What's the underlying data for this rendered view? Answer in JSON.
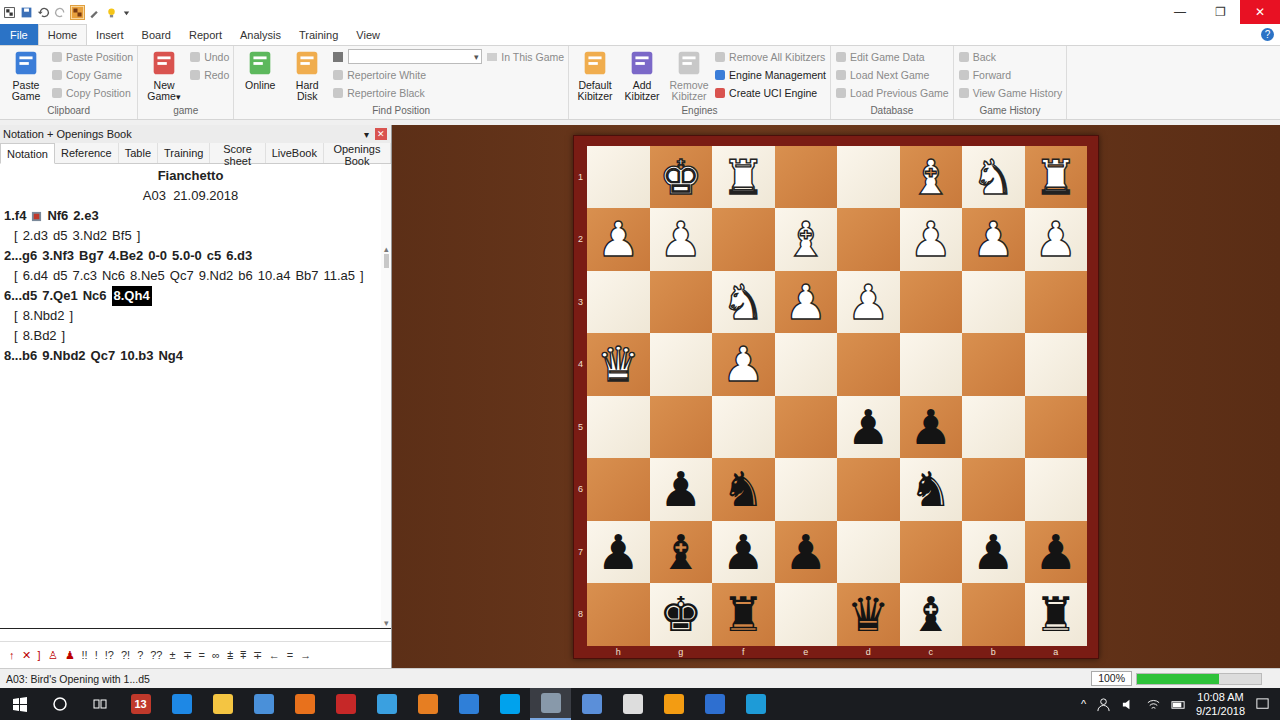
{
  "window": {
    "title": "",
    "controls": [
      "—",
      "❐",
      "✕"
    ]
  },
  "ribbon": {
    "tabs": [
      {
        "label": "File",
        "selected": false,
        "kind": "file"
      },
      {
        "label": "Home",
        "selected": true,
        "kind": "tab"
      },
      {
        "label": "Insert",
        "selected": false,
        "kind": "tab"
      },
      {
        "label": "Board",
        "selected": false,
        "kind": "tab"
      },
      {
        "label": "Report",
        "selected": false,
        "kind": "tab"
      },
      {
        "label": "Analysis",
        "selected": false,
        "kind": "tab"
      },
      {
        "label": "Training",
        "selected": false,
        "kind": "tab"
      },
      {
        "label": "View",
        "selected": false,
        "kind": "tab"
      }
    ],
    "help": "?",
    "groups": [
      {
        "label": "Clipboard",
        "columns": [
          [
            {
              "kind": "large",
              "label": "Paste Game",
              "disabled": false
            }
          ],
          [
            {
              "kind": "small",
              "label": "Paste Position",
              "disabled": true
            },
            {
              "kind": "small",
              "label": "Copy Game",
              "disabled": true
            },
            {
              "kind": "small",
              "label": "Copy Position",
              "disabled": true
            }
          ]
        ]
      },
      {
        "label": "game",
        "columns": [
          [
            {
              "kind": "large",
              "label": "New Game",
              "disabled": false,
              "dropdown": "▾"
            }
          ],
          [
            {
              "kind": "small",
              "label": "Undo",
              "disabled": true
            },
            {
              "kind": "small",
              "label": "Redo",
              "disabled": true
            }
          ]
        ]
      },
      {
        "label": "Find Position",
        "columns": [
          [
            {
              "kind": "large",
              "label": "Online",
              "disabled": false
            }
          ],
          [
            {
              "kind": "large",
              "label": "Hard Disk",
              "disabled": false
            }
          ],
          [
            {
              "kind": "search",
              "label": "In This Game",
              "value": "",
              "arrow": "▾",
              "disabled": true
            },
            {
              "kind": "small",
              "label": "Repertoire White",
              "disabled": true
            },
            {
              "kind": "small",
              "label": "Repertoire Black",
              "disabled": true
            }
          ]
        ]
      },
      {
        "label": "Engines",
        "columns": [
          [
            {
              "kind": "large",
              "label": "Default Kibitzer",
              "disabled": false
            }
          ],
          [
            {
              "kind": "large",
              "label": "Add Kibitzer",
              "disabled": false
            }
          ],
          [
            {
              "kind": "large",
              "label": "Remove Kibitzer",
              "disabled": true
            }
          ],
          [
            {
              "kind": "small",
              "label": "Remove All Kibitzers",
              "disabled": true
            },
            {
              "kind": "small",
              "label": "Engine Management",
              "disabled": false
            },
            {
              "kind": "small",
              "label": "Create UCI Engine",
              "disabled": false
            }
          ]
        ]
      },
      {
        "label": "Database",
        "columns": [
          [
            {
              "kind": "small",
              "label": "Edit Game Data",
              "disabled": true
            },
            {
              "kind": "small",
              "label": "Load Next Game",
              "disabled": true
            },
            {
              "kind": "small",
              "label": "Load Previous Game",
              "disabled": true
            }
          ]
        ]
      },
      {
        "label": "Game History",
        "columns": [
          [
            {
              "kind": "small",
              "label": "Back",
              "disabled": true
            },
            {
              "kind": "small",
              "label": "Forward",
              "disabled": true
            },
            {
              "kind": "small",
              "label": "View Game History",
              "disabled": true
            }
          ]
        ]
      }
    ]
  },
  "panel": {
    "title": "Notation + Openings Book",
    "menu": "▾",
    "close": "✕",
    "tabs": [
      {
        "label": "Notation",
        "selected": true
      },
      {
        "label": "Reference",
        "selected": false
      },
      {
        "label": "Table",
        "selected": false
      },
      {
        "label": "Training",
        "selected": false
      },
      {
        "label": "Score sheet",
        "selected": false
      },
      {
        "label": "LiveBook",
        "selected": false
      },
      {
        "label": "Openings Book",
        "selected": false
      }
    ],
    "game_title": "Fianchetto",
    "game_info": "A03  21.09.2018",
    "scroll": {
      "up": "▴",
      "down": "▾"
    },
    "lines": [
      {
        "kind": "main",
        "tokens": [
          {
            "text": "1.f4",
            "selected": false,
            "marked": true
          },
          {
            "text": "Nf6",
            "selected": false,
            "marked": false
          },
          {
            "text": "2.e3",
            "selected": false,
            "marked": false
          }
        ]
      },
      {
        "kind": "variation",
        "tokens": [
          {
            "text": "[",
            "selected": false,
            "marked": false
          },
          {
            "text": "2.d3",
            "selected": false,
            "marked": false
          },
          {
            "text": "d5",
            "selected": false,
            "marked": false
          },
          {
            "text": "3.Nd2",
            "selected": false,
            "marked": false
          },
          {
            "text": "Bf5",
            "selected": false,
            "marked": false
          },
          {
            "text": "]",
            "selected": false,
            "marked": false
          }
        ]
      },
      {
        "kind": "main",
        "tokens": [
          {
            "text": "2...g6",
            "selected": false,
            "marked": false
          },
          {
            "text": "3.Nf3",
            "selected": false,
            "marked": false
          },
          {
            "text": "Bg7",
            "selected": false,
            "marked": false
          },
          {
            "text": "4.Be2",
            "selected": false,
            "marked": false
          },
          {
            "text": "0-0",
            "selected": false,
            "marked": false
          },
          {
            "text": "5.0-0",
            "selected": false,
            "marked": false
          },
          {
            "text": "c5",
            "selected": false,
            "marked": false
          },
          {
            "text": "6.d3",
            "selected": false,
            "marked": false
          }
        ]
      },
      {
        "kind": "variation",
        "tokens": [
          {
            "text": "[",
            "selected": false,
            "marked": false
          },
          {
            "text": "6.d4",
            "selected": false,
            "marked": false
          },
          {
            "text": "d5",
            "selected": false,
            "marked": false
          },
          {
            "text": "7.c3",
            "selected": false,
            "marked": false
          },
          {
            "text": "Nc6",
            "selected": false,
            "marked": false
          },
          {
            "text": "8.Ne5",
            "selected": false,
            "marked": false
          },
          {
            "text": "Qc7",
            "selected": false,
            "marked": false
          },
          {
            "text": "9.Nd2",
            "selected": false,
            "marked": false
          },
          {
            "text": "b6",
            "selected": false,
            "marked": false
          },
          {
            "text": "10.a4",
            "selected": false,
            "marked": false
          },
          {
            "text": "Bb7",
            "selected": false,
            "marked": false
          },
          {
            "text": "11.a5",
            "selected": false,
            "marked": false
          },
          {
            "text": "]",
            "selected": false,
            "marked": false
          }
        ]
      },
      {
        "kind": "main",
        "tokens": [
          {
            "text": "6...d5",
            "selected": false,
            "marked": false
          },
          {
            "text": "7.Qe1",
            "selected": false,
            "marked": false
          },
          {
            "text": "Nc6",
            "selected": false,
            "marked": false
          },
          {
            "text": "8.Qh4",
            "selected": true,
            "marked": false
          }
        ]
      },
      {
        "kind": "variation",
        "tokens": [
          {
            "text": "[",
            "selected": false,
            "marked": false
          },
          {
            "text": "8.Nbd2",
            "selected": false,
            "marked": false
          },
          {
            "text": "]",
            "selected": false,
            "marked": false
          }
        ]
      },
      {
        "kind": "variation",
        "tokens": [
          {
            "text": "[",
            "selected": false,
            "marked": false
          },
          {
            "text": "8.Bd2",
            "selected": false,
            "marked": false
          },
          {
            "text": "]",
            "selected": false,
            "marked": false
          }
        ]
      },
      {
        "kind": "main",
        "tokens": [
          {
            "text": "8...b6",
            "selected": false,
            "marked": false
          },
          {
            "text": "9.Nbd2",
            "selected": false,
            "marked": false
          },
          {
            "text": "Qc7",
            "selected": false,
            "marked": false
          },
          {
            "text": "10.b3",
            "selected": false,
            "marked": false
          },
          {
            "text": "Ng4",
            "selected": false,
            "marked": false
          }
        ]
      }
    ],
    "symbols": [
      "↑",
      "✕",
      "]",
      "♙",
      "♟",
      "!!",
      "!",
      "!?",
      "?!",
      "?",
      "??",
      "±",
      "∓",
      "=",
      "∞",
      "⩲",
      "⩱",
      "∓",
      "←",
      "=",
      "→"
    ]
  },
  "board": {
    "files": [
      "h",
      "g",
      "f",
      "e",
      "d",
      "c",
      "b",
      "a"
    ],
    "ranks": [
      {
        "label": "1",
        "squares": [
          "",
          {
            "glyph": "♚",
            "side": "white"
          },
          {
            "glyph": "♜",
            "side": "white"
          },
          "",
          "",
          {
            "glyph": "♝",
            "side": "white"
          },
          {
            "glyph": "♞",
            "side": "white"
          },
          {
            "glyph": "♜",
            "side": "white"
          }
        ]
      },
      {
        "label": "2",
        "squares": [
          {
            "glyph": "♟",
            "side": "white"
          },
          {
            "glyph": "♟",
            "side": "white"
          },
          "",
          {
            "glyph": "♝",
            "side": "white"
          },
          "",
          {
            "glyph": "♟",
            "side": "white"
          },
          {
            "glyph": "♟",
            "side": "white"
          },
          {
            "glyph": "♟",
            "side": "white"
          }
        ]
      },
      {
        "label": "3",
        "squares": [
          "",
          "",
          {
            "glyph": "♞",
            "side": "white"
          },
          {
            "glyph": "♟",
            "side": "white"
          },
          {
            "glyph": "♟",
            "side": "white"
          },
          "",
          "",
          ""
        ]
      },
      {
        "label": "4",
        "squares": [
          {
            "glyph": "♛",
            "side": "white"
          },
          "",
          {
            "glyph": "♟",
            "side": "white"
          },
          "",
          "",
          "",
          "",
          ""
        ]
      },
      {
        "label": "5",
        "squares": [
          "",
          "",
          "",
          "",
          {
            "glyph": "♟",
            "side": "black"
          },
          {
            "glyph": "♟",
            "side": "black"
          },
          "",
          ""
        ]
      },
      {
        "label": "6",
        "squares": [
          "",
          {
            "glyph": "♟",
            "side": "black"
          },
          {
            "glyph": "♞",
            "side": "black"
          },
          "",
          "",
          {
            "glyph": "♞",
            "side": "black"
          },
          "",
          ""
        ]
      },
      {
        "label": "7",
        "squares": [
          {
            "glyph": "♟",
            "side": "black"
          },
          {
            "glyph": "♝",
            "side": "black"
          },
          {
            "glyph": "♟",
            "side": "black"
          },
          {
            "glyph": "♟",
            "side": "black"
          },
          "",
          "",
          {
            "glyph": "♟",
            "side": "black"
          },
          {
            "glyph": "♟",
            "side": "black"
          }
        ]
      },
      {
        "label": "8",
        "squares": [
          "",
          {
            "glyph": "♚",
            "side": "black"
          },
          {
            "glyph": "♜",
            "side": "black"
          },
          "",
          {
            "glyph": "♛",
            "side": "black"
          },
          {
            "glyph": "♝",
            "side": "black"
          },
          "",
          {
            "glyph": "♜",
            "side": "black"
          }
        ]
      }
    ]
  },
  "status_bar": {
    "text": "A03: Bird's Opening with 1...d5",
    "zoom": "100%",
    "level": 0.66
  },
  "taskbar": {
    "apps": [
      {
        "text": "13",
        "color": "#c0392b",
        "active": false
      },
      {
        "text": "",
        "color": "#1e88e5",
        "active": false
      },
      {
        "text": "",
        "color": "#f4c542",
        "active": false
      },
      {
        "text": "",
        "color": "#4a90d9",
        "active": false
      },
      {
        "text": "",
        "color": "#e8711c",
        "active": false
      },
      {
        "text": "",
        "color": "#c62828",
        "active": false
      },
      {
        "text": "",
        "color": "#3aa0e0",
        "active": false
      },
      {
        "text": "",
        "color": "#e67e22",
        "active": false
      },
      {
        "text": "",
        "color": "#2f7fd8",
        "active": false
      },
      {
        "text": "",
        "color": "#00a2ed",
        "active": false
      },
      {
        "text": "",
        "color": "#8899aa",
        "active": true
      },
      {
        "text": "",
        "color": "#5b8fd9",
        "active": false
      },
      {
        "text": "",
        "color": "#dddddd",
        "active": false
      },
      {
        "text": "",
        "color": "#f39c12",
        "active": false
      },
      {
        "text": "",
        "color": "#2e6fd0",
        "active": false
      },
      {
        "text": "",
        "color": "#1e9bd7",
        "active": false
      }
    ],
    "tray": {
      "chevron": "^",
      "time": "10:08 AM",
      "date": "9/21/2018"
    }
  }
}
